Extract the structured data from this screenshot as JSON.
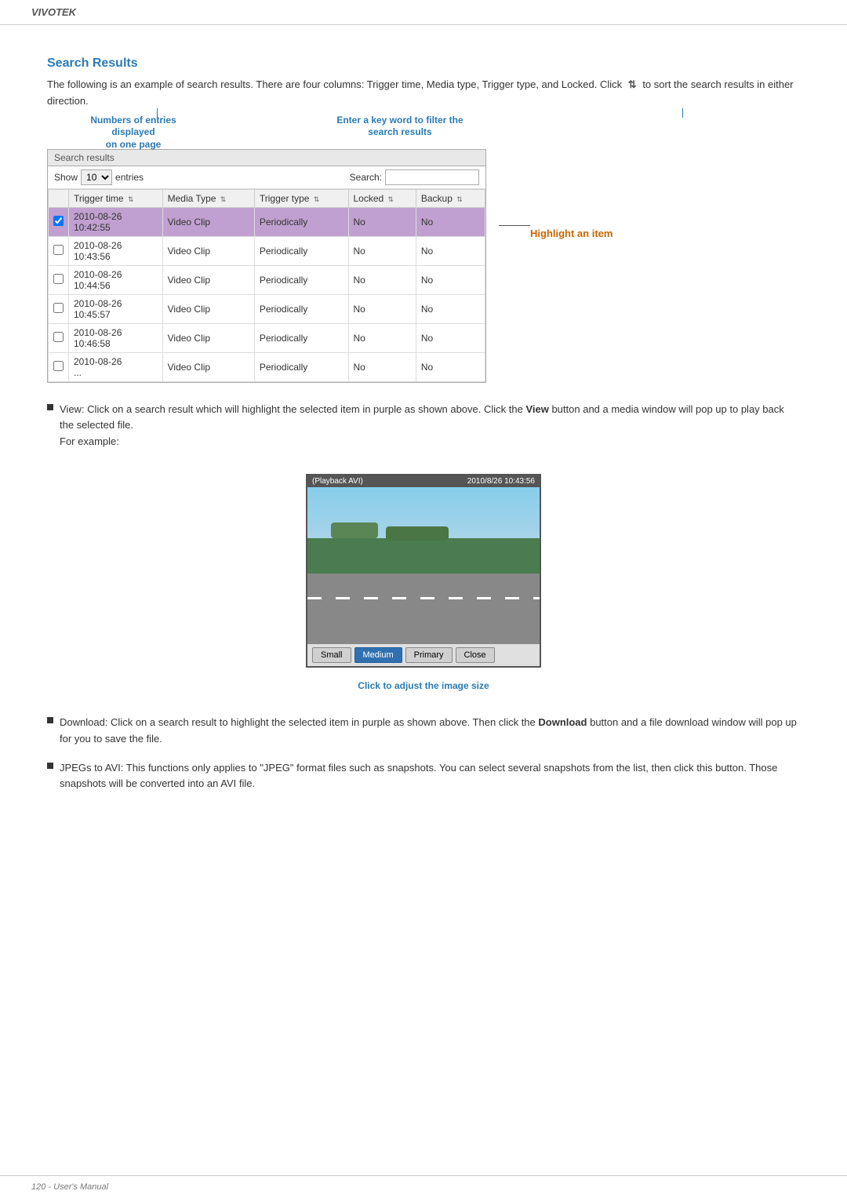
{
  "brand": "VIVOTEK",
  "page_label": "120 - User's Manual",
  "section_title": "Search Results",
  "intro_paragraph": "The following is an example of search results. There are four columns: Trigger time, Media type, Trigger type, and Locked. Click",
  "intro_paragraph2": "to sort the search results in either direction.",
  "table": {
    "title": "Search results",
    "show_label": "Show",
    "show_value": "10",
    "entries_label": "entries",
    "search_label": "Search:",
    "search_placeholder": "",
    "columns": [
      "Trigger time",
      "Media Type",
      "Trigger type",
      "Locked",
      "Backup"
    ],
    "rows": [
      {
        "trigger_time": "2010-08-26\n10:42:55",
        "media_type": "Video Clip",
        "trigger_type": "Periodically",
        "locked": "No",
        "backup": "No",
        "highlighted": true
      },
      {
        "trigger_time": "2010-08-26\n10:43:56",
        "media_type": "Video Clip",
        "trigger_type": "Periodically",
        "locked": "No",
        "backup": "No",
        "highlighted": false
      },
      {
        "trigger_time": "2010-08-26\n10:44:56",
        "media_type": "Video Clip",
        "trigger_type": "Periodically",
        "locked": "No",
        "backup": "No",
        "highlighted": false
      },
      {
        "trigger_time": "2010-08-26\n10:45:57",
        "media_type": "Video Clip",
        "trigger_type": "Periodically",
        "locked": "No",
        "backup": "No",
        "highlighted": false
      },
      {
        "trigger_time": "2010-08-26\n10:46:58",
        "media_type": "Video Clip",
        "trigger_type": "Periodically",
        "locked": "No",
        "backup": "No",
        "highlighted": false
      },
      {
        "trigger_time": "2010-08-26\n...",
        "media_type": "Video Clip",
        "trigger_type": "Periodically",
        "locked": "No",
        "backup": "No",
        "highlighted": false
      }
    ]
  },
  "annotations": {
    "numbers_label": "Numbers of entries displayed\non one page",
    "search_label": "Enter a key word to filter the\nsearch results",
    "highlight_label": "Highlight an item"
  },
  "playback": {
    "title": "(Playback AVI)",
    "timestamp": "2010/8/26 10:43:56",
    "buttons": [
      "Small",
      "Medium",
      "Primary",
      "Close"
    ],
    "active_button": "Medium",
    "caption": "Click to adjust the image size"
  },
  "bullets": [
    {
      "id": "view",
      "text1": "View: Click on a search result which will highlight the selected item in purple as shown above. Click the ",
      "bold": "View",
      "text2": " button and a media window will pop up to play back the selected file.\nFor example:"
    },
    {
      "id": "download",
      "text1": "Download: Click on a search result to highlight the selected item in purple as shown above. Then click the ",
      "bold": "Download",
      "text2": " button and a file download window will pop up for you to save the file."
    },
    {
      "id": "jpegs",
      "text1": "JPEGs to AVI: This functions only applies to \"JPEG\" format files such as snapshots. You can select several snapshots from the list, then click this button. Those snapshots will be converted into an AVI file.",
      "bold": "",
      "text2": ""
    }
  ]
}
